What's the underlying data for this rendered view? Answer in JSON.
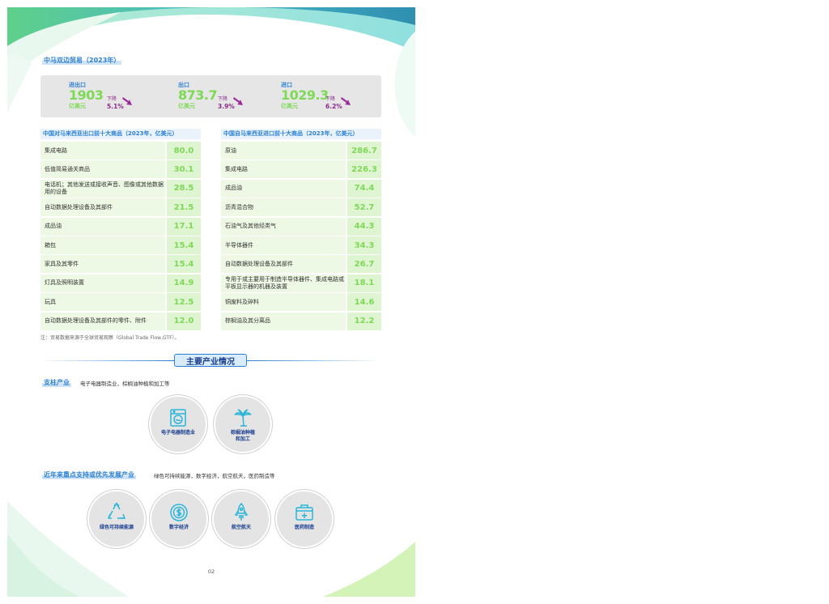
{
  "trade": {
    "section_title": "中马双边贸易（2023年）",
    "stats": [
      {
        "label": "进出口",
        "value": "1903",
        "unit": "亿美元",
        "change_label": "下降",
        "change_pct": "5.1%"
      },
      {
        "label": "出口",
        "value": "873.7",
        "unit": "亿美元",
        "change_label": "下降",
        "change_pct": "3.9%"
      },
      {
        "label": "进口",
        "value": "1029.3",
        "unit": "亿美元",
        "change_label": "下降",
        "change_pct": "6.2%"
      }
    ]
  },
  "exports": {
    "title": "中国对马来西亚出口前十大商品（2023年，亿美元）",
    "rows": [
      {
        "name": "集成电路",
        "value": "80.0"
      },
      {
        "name": "低值简易通关商品",
        "value": "30.1"
      },
      {
        "name": "电话机；其他发送或接收声音、图像或其他数据用的设备",
        "value": "28.5"
      },
      {
        "name": "自动数据处理设备及其部件",
        "value": "21.5"
      },
      {
        "name": "成品油",
        "value": "17.1"
      },
      {
        "name": "箱包",
        "value": "15.4"
      },
      {
        "name": "家具及其零件",
        "value": "15.4"
      },
      {
        "name": "灯具及照明装置",
        "value": "14.9"
      },
      {
        "name": "玩具",
        "value": "12.5"
      },
      {
        "name": "自动数据处理设备及其部件的零件、附件",
        "value": "12.0"
      }
    ]
  },
  "imports": {
    "title": "中国自马来西亚进口前十大商品（2023年，亿美元）",
    "rows": [
      {
        "name": "原油",
        "value": "286.7"
      },
      {
        "name": "集成电路",
        "value": "226.3"
      },
      {
        "name": "成品油",
        "value": "74.4"
      },
      {
        "name": "沥青混合物",
        "value": "52.7"
      },
      {
        "name": "石油气及其他烃类气",
        "value": "44.3"
      },
      {
        "name": "半导体器件",
        "value": "34.3"
      },
      {
        "name": "自动数据处理设备及其部件",
        "value": "26.7"
      },
      {
        "name": "专用于或主要用于制造半导体器件、集成电路或平板显示器的机器及装置",
        "value": "18.1"
      },
      {
        "name": "铜废料及碎料",
        "value": "14.6"
      },
      {
        "name": "棕榈油及其分离品",
        "value": "12.2"
      }
    ]
  },
  "note": "注：贸易数据来源于全球贸易观察（Global Trade Flow,GTF）。",
  "industries": {
    "banner": "主要产业情况",
    "pillar": {
      "label": "支柱产业",
      "text": "电子电器制造业，棕榈油种植和加工等",
      "items": [
        {
          "icon": "washing-machine-icon",
          "label": "电子电器制造业"
        },
        {
          "icon": "palm-tree-icon",
          "label": "棕榈油种植\n和加工"
        }
      ]
    },
    "priority": {
      "label": "近年来重点支持或优先发展产业",
      "text": "绿色可持续能源，数字经济，航空航天，医药制造等",
      "items": [
        {
          "icon": "recycle-icon",
          "label": "绿色可持续能源"
        },
        {
          "icon": "digital-coin-icon",
          "label": "数字经济"
        },
        {
          "icon": "rocket-icon",
          "label": "航空航天"
        },
        {
          "icon": "medical-kit-icon",
          "label": "医药制造"
        }
      ]
    }
  },
  "page_number": "02",
  "colors": {
    "accent_blue": "#2a7fd4",
    "value_green": "#7ed957",
    "decline_purple": "#8a2a8a",
    "teal_wave": "#3aa6b8"
  }
}
